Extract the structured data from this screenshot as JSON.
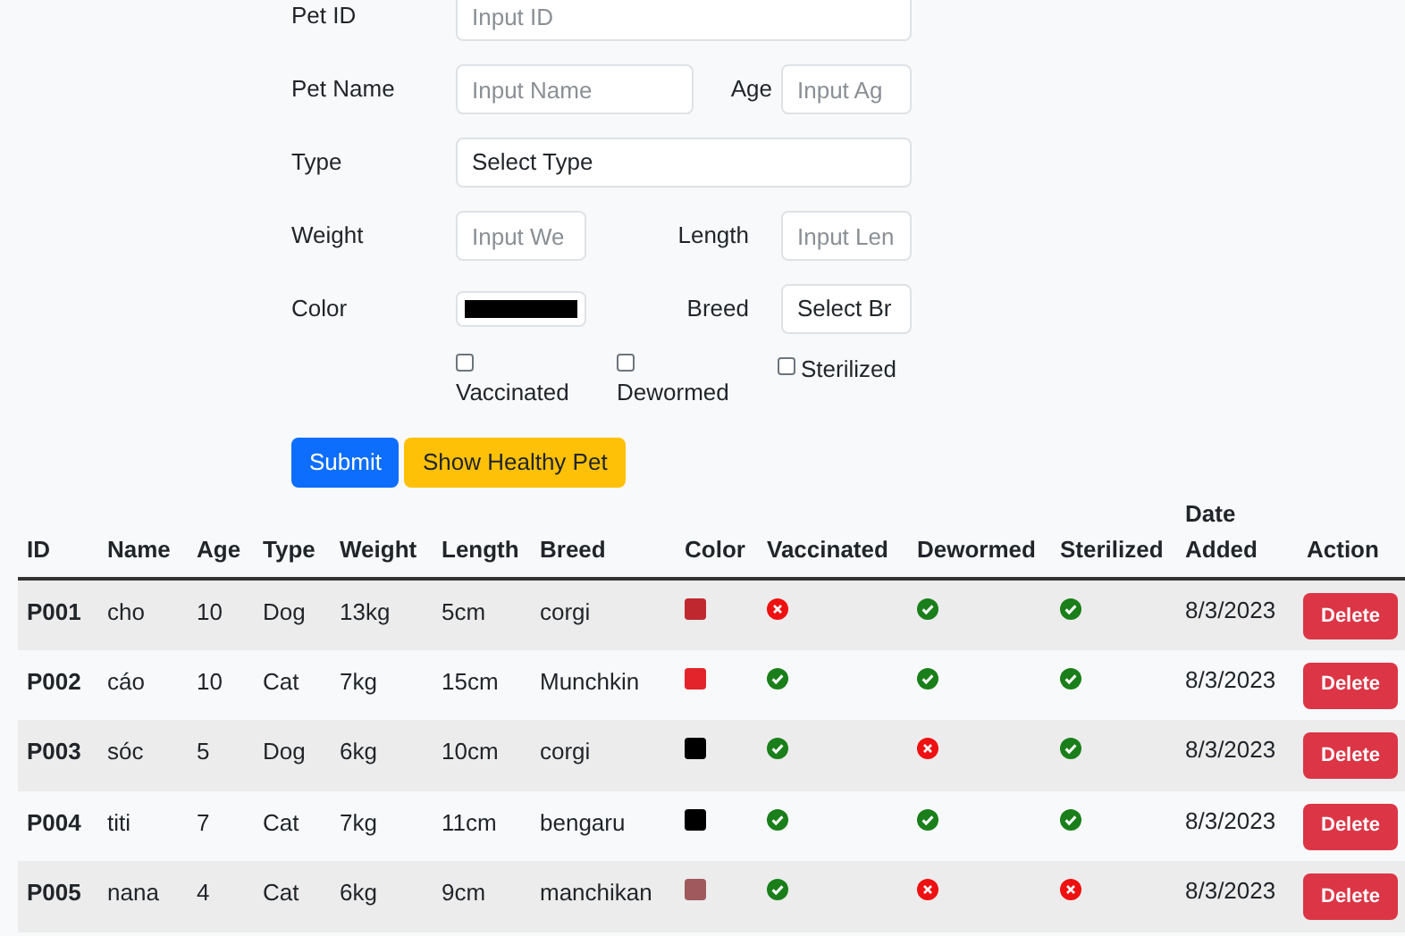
{
  "form": {
    "pet_id": {
      "label": "Pet ID",
      "placeholder": "Input ID"
    },
    "pet_name": {
      "label": "Pet Name",
      "placeholder": "Input Name"
    },
    "age": {
      "label": "Age",
      "placeholder": "Input Ag"
    },
    "type": {
      "label": "Type",
      "value": "Select Type"
    },
    "weight": {
      "label": "Weight",
      "placeholder": "Input We"
    },
    "length": {
      "label": "Length",
      "placeholder": "Input Len"
    },
    "color": {
      "label": "Color",
      "color": "#000000"
    },
    "breed": {
      "label": "Breed",
      "value": "Select Br"
    },
    "checkboxes": [
      {
        "label": "Vaccinated",
        "checked": false
      },
      {
        "label": "Dewormed",
        "checked": false
      },
      {
        "label": "Sterilized",
        "checked": false
      }
    ],
    "buttons": [
      {
        "label": "Submit",
        "kind": "primary"
      },
      {
        "label": "Show Healthy Pet",
        "kind": "warning"
      }
    ]
  },
  "table": {
    "columns": [
      "ID",
      "Name",
      "Age",
      "Type",
      "Weight",
      "Length",
      "Breed",
      "Color",
      "Vaccinated",
      "Dewormed",
      "Sterilized",
      "Date Added",
      "Action"
    ],
    "rows": [
      {
        "id": "P001",
        "name": "cho",
        "age": "10",
        "type": "Dog",
        "weight": "13kg",
        "length": "5cm",
        "breed": "corgi",
        "color": "#c0282f",
        "vaccinated": false,
        "dewormed": true,
        "sterilized": true,
        "date": "8/3/2023",
        "action": "Delete"
      },
      {
        "id": "P002",
        "name": "cáo",
        "age": "10",
        "type": "Cat",
        "weight": "7kg",
        "length": "15cm",
        "breed": "Munchkin",
        "color": "#e3242b",
        "vaccinated": true,
        "dewormed": true,
        "sterilized": true,
        "date": "8/3/2023",
        "action": "Delete"
      },
      {
        "id": "P003",
        "name": "sóc",
        "age": "5",
        "type": "Dog",
        "weight": "6kg",
        "length": "10cm",
        "breed": "corgi",
        "color": "#000000",
        "vaccinated": true,
        "dewormed": false,
        "sterilized": true,
        "date": "8/3/2023",
        "action": "Delete"
      },
      {
        "id": "P004",
        "name": "titi",
        "age": "7",
        "type": "Cat",
        "weight": "7kg",
        "length": "11cm",
        "breed": "bengaru",
        "color": "#000000",
        "vaccinated": true,
        "dewormed": true,
        "sterilized": true,
        "date": "8/3/2023",
        "action": "Delete"
      },
      {
        "id": "P005",
        "name": "nana",
        "age": "4",
        "type": "Cat",
        "weight": "6kg",
        "length": "9cm",
        "breed": "manchikan",
        "color": "#a05a5e",
        "vaccinated": true,
        "dewormed": false,
        "sterilized": false,
        "date": "8/3/2023",
        "action": "Delete"
      }
    ]
  }
}
